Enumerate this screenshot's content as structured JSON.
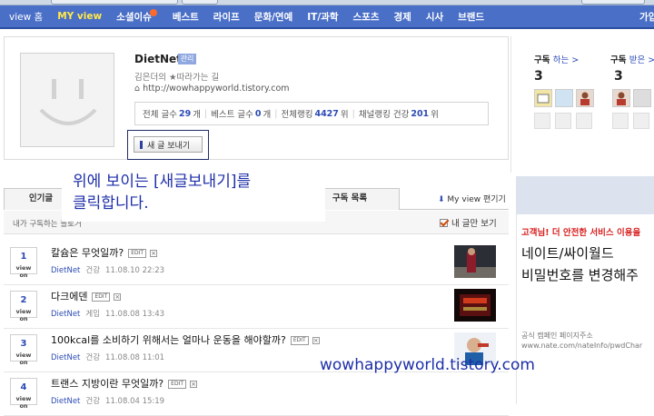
{
  "nav": {
    "items": [
      {
        "label": "view 홈",
        "active": false
      },
      {
        "label": "MY view",
        "active": true
      },
      {
        "label": "소셜이슈",
        "active": false,
        "new": true
      },
      {
        "label": "베스트",
        "active": false
      },
      {
        "label": "라이프",
        "active": false
      },
      {
        "label": "문화/연예",
        "active": false
      },
      {
        "label": "IT/과학",
        "active": false
      },
      {
        "label": "스포츠",
        "active": false
      },
      {
        "label": "경제",
        "active": false
      },
      {
        "label": "시사",
        "active": false
      },
      {
        "label": "브랜드",
        "active": false
      },
      {
        "label": "가입",
        "active": false
      }
    ]
  },
  "profile": {
    "blog_name": "DietNet",
    "badge": "관리",
    "slogan": "김은더의 ★따라가는 길",
    "url": "http://wowhappyworld.tistory.com",
    "stats": [
      {
        "label": "전체 글수",
        "value": "29",
        "unit": "개"
      },
      {
        "label": "베스트 글수",
        "value": "0",
        "unit": "개"
      },
      {
        "label": "전체랭킹",
        "value": "4427",
        "unit": "위"
      },
      {
        "label": "채널랭킹 건강",
        "value": "201",
        "unit": "위"
      }
    ],
    "new_post_button": "새 글 보내기"
  },
  "subscribe": {
    "doing": {
      "label": "구독",
      "link": "하는 >",
      "count": "3"
    },
    "received": {
      "label": "구독",
      "link": "받은 >",
      "count": "3"
    }
  },
  "tabs": {
    "popular": "인기글",
    "subscription_list": "구독 목록",
    "my_view_edit": "My view 편기기"
  },
  "list": {
    "header_label": "내가 구독하는 블로거",
    "my_posts_only": "내 글만 보기",
    "rank_label": "view on",
    "edit_tag": "EDIT",
    "rows": [
      {
        "rank": "1",
        "title": "칼슘은 무엇일까?",
        "blog": "DietNet",
        "category": "건강",
        "date": "11.08.10 22:23"
      },
      {
        "rank": "2",
        "title": "다크에덴",
        "blog": "DietNet",
        "category": "게임",
        "date": "11.08.08 13:43"
      },
      {
        "rank": "3",
        "title": "100kcal를 소비하기 위해서는 얼마나 운동을 해야할까?",
        "blog": "DietNet",
        "category": "건강",
        "date": "11.08.08 11:01"
      },
      {
        "rank": "4",
        "title": "트랜스 지방이란 무엇일까?",
        "blog": "DietNet",
        "category": "건강",
        "date": "11.08.04 15:19"
      }
    ]
  },
  "annotation": {
    "line1": "위에 보이는 [새글보내기]를",
    "line2": "클릭합니다."
  },
  "watermark": "wowhappyworld.tistory.com",
  "ad": {
    "line1": "고객님! 더 안전한 서비스 이용을",
    "line2": "네이트/싸이월드",
    "line3": "비밀번호를 변경해주",
    "line4": "공식 캠페인 페이지주소",
    "line5": "www.nate.com/nateInfo/pwdChar"
  }
}
